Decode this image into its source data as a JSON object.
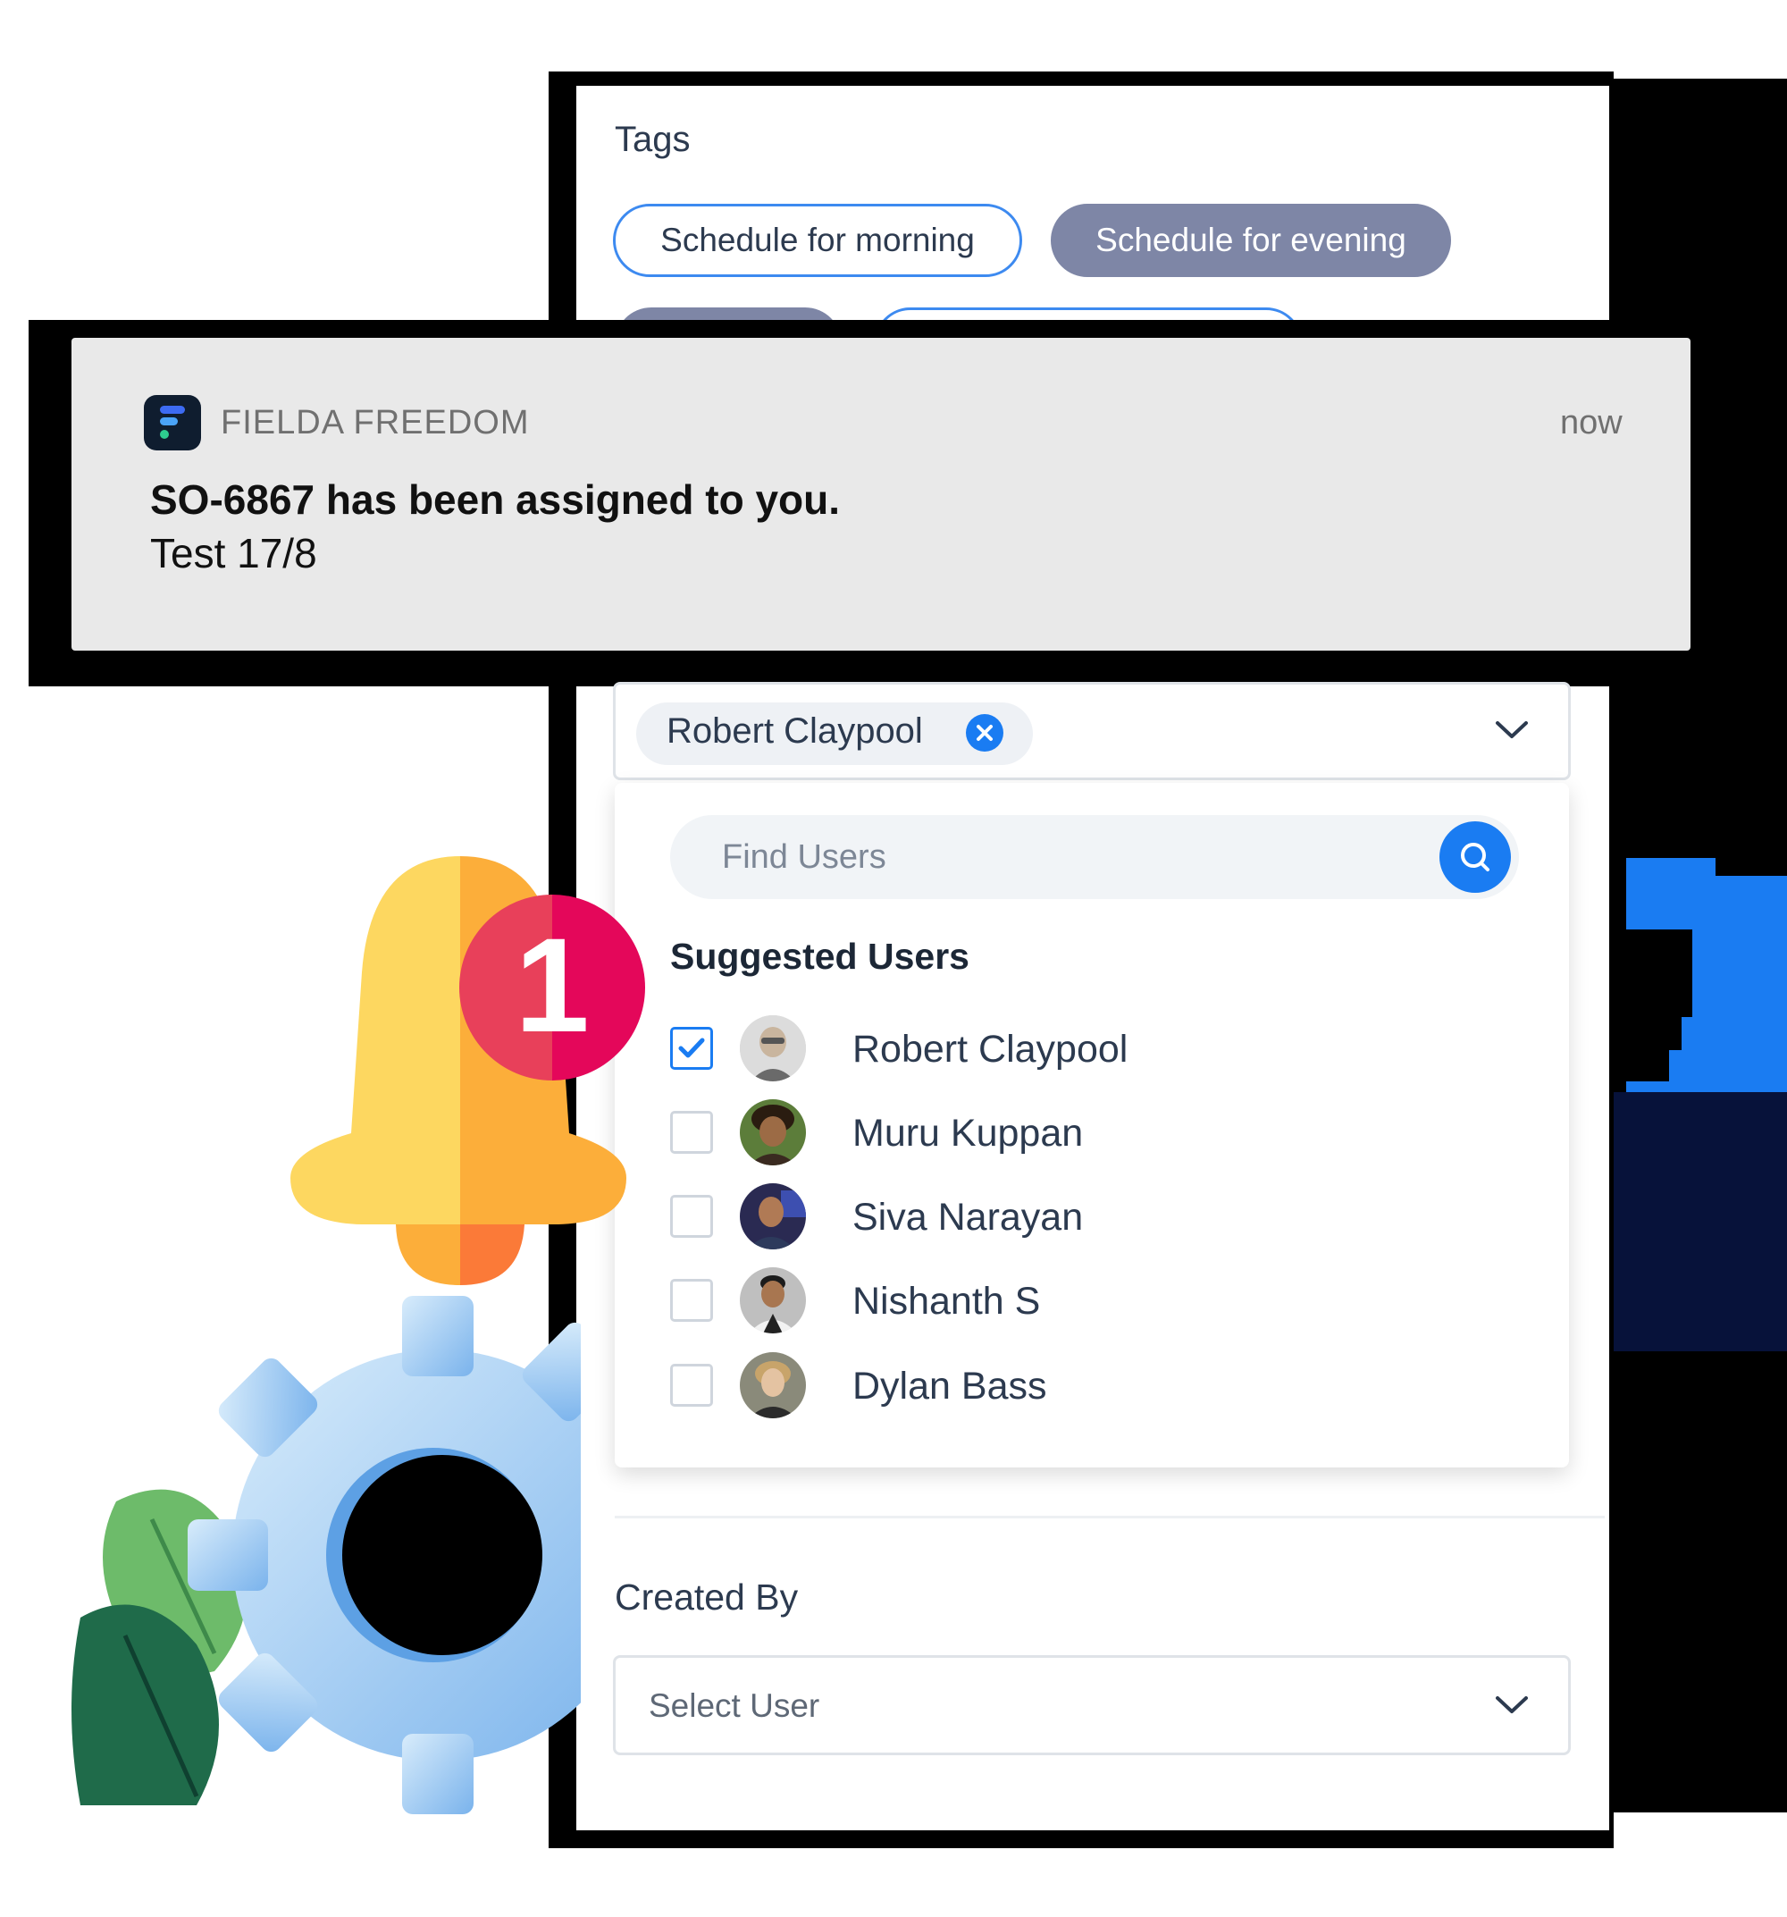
{
  "tags": {
    "title": "Tags",
    "items": [
      "Schedule for morning",
      "Schedule for evening"
    ],
    "selected_index": 1
  },
  "notification": {
    "app_name": "FIELDA FREEDOM",
    "time": "now",
    "title": "SO-6867 has been assigned to you.",
    "body": "Test 17/8"
  },
  "badge": {
    "count": "1"
  },
  "assignee": {
    "selected_chip": "Robert Claypool",
    "search_placeholder": "Find Users",
    "suggested_title": "Suggested Users",
    "users": [
      {
        "name": "Robert Claypool",
        "checked": true
      },
      {
        "name": "Muru Kuppan",
        "checked": false
      },
      {
        "name": "Siva Narayan",
        "checked": false
      },
      {
        "name": "Nishanth S",
        "checked": false
      },
      {
        "name": "Dylan Bass",
        "checked": false
      }
    ]
  },
  "created_by": {
    "title": "Created By",
    "placeholder": "Select User"
  },
  "colors": {
    "accent": "#1a7cf2",
    "tag_filled": "#7e86a6",
    "tag_outline": "#3d8af0",
    "notification_bg": "#e9e9e9",
    "text_primary": "#2c3a4f",
    "badge": "#e8405a",
    "bell": "#fdd760"
  },
  "icons": {
    "app": "fielda-logo-icon",
    "bell": "bell-icon",
    "gear": "gear-icon",
    "search": "search-icon",
    "remove": "close-circle-icon",
    "dropdown": "chevron-down-icon",
    "check": "checkmark-icon"
  }
}
